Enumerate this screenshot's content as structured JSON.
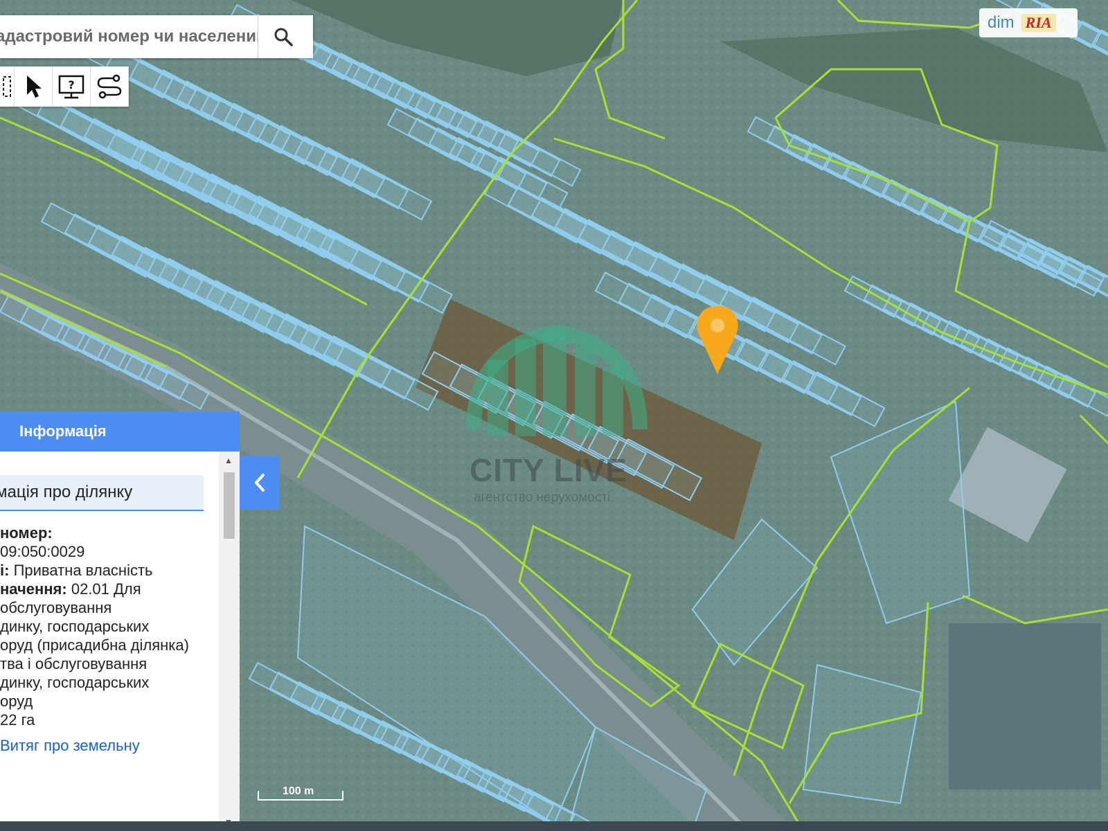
{
  "search": {
    "placeholder": "адастровий номер чи населений"
  },
  "toolbar": {
    "tools": [
      "select-area-tool",
      "pointer-tool",
      "info-tool",
      "measure-route-tool"
    ]
  },
  "badge": {
    "dim": "dim",
    "ria": "RIA"
  },
  "panel": {
    "header": "Інформація",
    "section_title": "мація про ділянку",
    "lines": [
      {
        "label": " номер:",
        "value": ""
      },
      {
        "label": "",
        "value": "09:050:0029"
      },
      {
        "label": "і:",
        "value": " Приватна власність"
      },
      {
        "label": "начення:",
        "value": " 02.01 Для"
      },
      {
        "label": "",
        "value": " обслуговування"
      },
      {
        "label": "",
        "value": "динку, господарських"
      },
      {
        "label": "",
        "value": "оруд (присадибна ділянка)"
      },
      {
        "label": "",
        "value": "тва і обслуговування"
      },
      {
        "label": "",
        "value": "динку, господарських"
      },
      {
        "label": "",
        "value": "оруд"
      },
      {
        "label": "",
        "value": "22 га"
      }
    ],
    "link": "Витяг про земельну"
  },
  "watermark": {
    "title": "CITY LIVE",
    "subtitle": "агентство нерухомості"
  },
  "scale": {
    "label": "100 m"
  },
  "colors": {
    "parcel": "#8ecdf0",
    "boundary": "#a6e22e",
    "marker": "#f7a81b",
    "panel_header": "#4c8df1"
  }
}
